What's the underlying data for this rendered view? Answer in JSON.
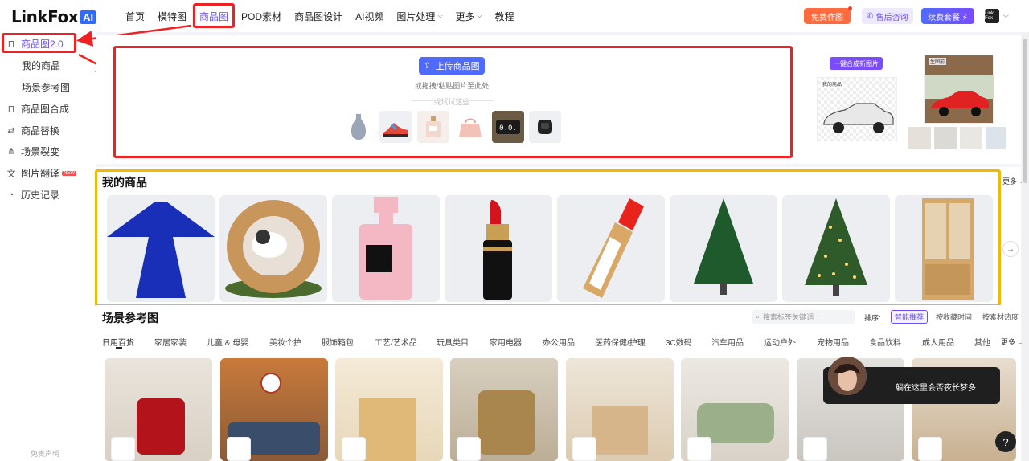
{
  "logo": {
    "text": "LinkFox",
    "badge": "AI"
  },
  "nav": {
    "items": [
      {
        "label": "首页"
      },
      {
        "label": "模特图"
      },
      {
        "label": "商品图"
      },
      {
        "label": "POD素材"
      },
      {
        "label": "商品图设计"
      },
      {
        "label": "AI视频"
      },
      {
        "label": "图片处理"
      },
      {
        "label": "更多"
      },
      {
        "label": "教程"
      }
    ],
    "active": "商品图"
  },
  "header_actions": {
    "free": "免费作图",
    "support": "售后咨询",
    "renew": "续费套餐 ⚡",
    "avatar": "Link Fox"
  },
  "sidebar": {
    "items": [
      {
        "label": "商品图2.0",
        "icon": "bag-icon"
      },
      {
        "label": "我的商品"
      },
      {
        "label": "场景参考图"
      },
      {
        "label": "商品图合成",
        "icon": "bag-icon"
      },
      {
        "label": "商品替换",
        "icon": "swap-icon"
      },
      {
        "label": "场景裂变",
        "icon": "share-icon"
      },
      {
        "label": "图片翻译",
        "icon": "translate-icon",
        "badge": "NEW"
      },
      {
        "label": "历史记录",
        "icon": "history-icon"
      }
    ],
    "footer": "免责声明"
  },
  "upload": {
    "button": "上传商品图",
    "hint": "或拖拽/粘贴图片至此处",
    "try_label": "或试试这些"
  },
  "demo": {
    "generate_button": "一键合成新图片",
    "my_product_label": "我的商品",
    "generated_label": "生图前"
  },
  "my_products": {
    "title": "我的商品",
    "more": "更多 →"
  },
  "scenes": {
    "title": "场景参考图",
    "search_placeholder": "搜索标签关键词",
    "sort_label": "排序:",
    "sort_options": [
      "智能推荐",
      "按收藏时间",
      "按素材热度"
    ],
    "categories": [
      "日用百货",
      "家居家装",
      "儿童 & 母婴",
      "美妆个护",
      "服饰箱包",
      "工艺/艺术品",
      "玩具类目",
      "家用电器",
      "办公用品",
      "医药保健/护理",
      "3C数码",
      "汽车用品",
      "运动户外",
      "宠物用品",
      "食品饮料",
      "成人用品",
      "其他"
    ],
    "more": "更多 →"
  },
  "chat": {
    "text": "躺在这里会否夜长梦多"
  },
  "help": "?",
  "colors": {
    "accent": "#6b4eff",
    "annotation_red": "#e22222",
    "annotation_yellow": "#f5b800"
  }
}
